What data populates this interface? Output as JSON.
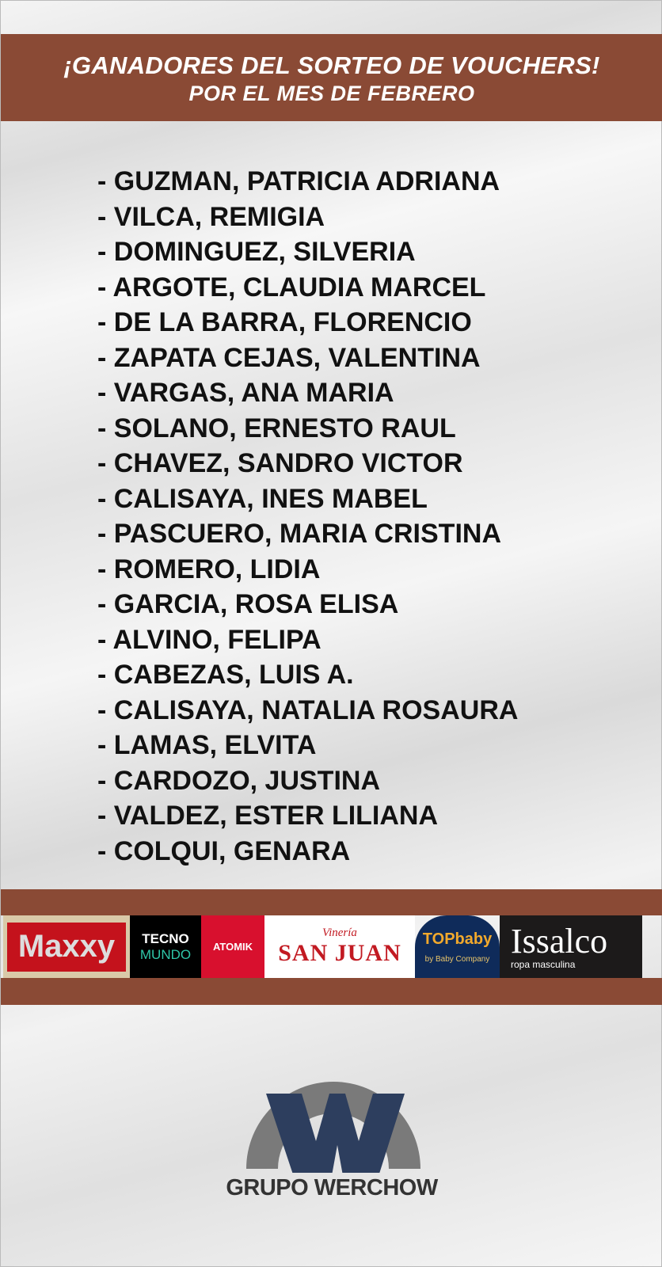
{
  "header": {
    "title": "¡GANADORES DEL SORTEO DE VOUCHERS!",
    "subtitle": "POR EL MES DE FEBRERO"
  },
  "winners": [
    "- GUZMAN, PATRICIA ADRIANA",
    "- VILCA, REMIGIA",
    "- DOMINGUEZ, SILVERIA",
    "- ARGOTE, CLAUDIA MARCEL",
    "- DE LA BARRA, FLORENCIO",
    "- ZAPATA CEJAS, VALENTINA",
    "- VARGAS, ANA MARIA",
    "- SOLANO, ERNESTO RAUL",
    "- CHAVEZ, SANDRO VICTOR",
    "- CALISAYA, INES MABEL",
    "- PASCUERO, MARIA CRISTINA",
    "- ROMERO, LIDIA",
    "- GARCIA, ROSA ELISA",
    "- ALVINO, FELIPA",
    "- CABEZAS, LUIS A.",
    "- CALISAYA, NATALIA ROSAURA",
    "- LAMAS, ELVITA",
    "- CARDOZO, JUSTINA",
    "- VALDEZ, ESTER LILIANA",
    "- COLQUI, GENARA"
  ],
  "sponsors": {
    "maxxy": "Maxxy",
    "tecno": "TECNO",
    "mundo": "MUNDO",
    "atomik": "ATOMIK",
    "vineria": "Vinería",
    "sanjuan": "SAN JUAN",
    "topbaby": "TOPbaby",
    "babycompany": "by Baby Company",
    "issalco": "Issalco",
    "issalco_sub": "ropa masculina"
  },
  "brand": {
    "name": "GRUPO WERCHOW",
    "header_color": "#8a4a35",
    "w_color": "#2d3e5e",
    "arc_color": "#7a7a7a"
  }
}
